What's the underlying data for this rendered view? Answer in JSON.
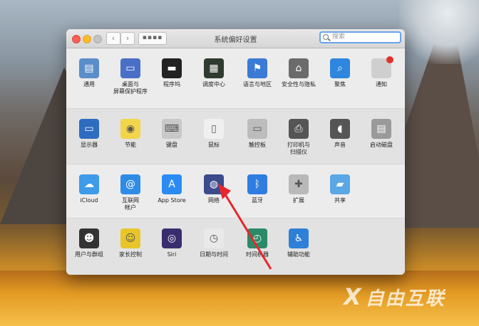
{
  "window": {
    "title": "系统偏好设置",
    "nav_back": "‹",
    "nav_forward": "›",
    "grid_glyph": "▪▪▪▪",
    "search_placeholder": "搜索"
  },
  "rows": [
    [
      {
        "name": "general",
        "label": "通用",
        "icon": "file-doc-icon",
        "color": "#5b8ec9"
      },
      {
        "name": "desktop-screensaver",
        "label": "桌面与\n屏幕保护程序",
        "icon": "desktop-icon",
        "color": "#4a6fc6"
      },
      {
        "name": "dock",
        "label": "程序坞",
        "icon": "dock-icon",
        "color": "#222222"
      },
      {
        "name": "mission-control",
        "label": "调度中心",
        "icon": "mission-control-icon",
        "color": "#2f3b2f"
      },
      {
        "name": "language-region",
        "label": "语言与地区",
        "icon": "flag-icon",
        "color": "#3a7bd5"
      },
      {
        "name": "security-privacy",
        "label": "安全性与隐私",
        "icon": "house-lock-icon",
        "color": "#6b6b6b"
      },
      {
        "name": "spotlight",
        "label": "聚焦",
        "icon": "magnifier-icon",
        "color": "#2e86de"
      },
      {
        "name": "notifications",
        "label": "通知",
        "icon": "notification-icon",
        "color": "#cfcfcf"
      }
    ],
    [
      {
        "name": "displays",
        "label": "显示器",
        "icon": "monitor-icon",
        "color": "#2d6cc0"
      },
      {
        "name": "energy-saver",
        "label": "节能",
        "icon": "bulb-icon",
        "color": "#f2d54b"
      },
      {
        "name": "keyboard",
        "label": "键盘",
        "icon": "keyboard-icon",
        "color": "#c8c8c8"
      },
      {
        "name": "mouse",
        "label": "鼠标",
        "icon": "mouse-icon",
        "color": "#f0f0f0"
      },
      {
        "name": "trackpad",
        "label": "触控板",
        "icon": "trackpad-icon",
        "color": "#bcbcbc"
      },
      {
        "name": "printers-scanners",
        "label": "打印机与\n扫描仪",
        "icon": "printer-icon",
        "color": "#555555"
      },
      {
        "name": "sound",
        "label": "声音",
        "icon": "speaker-icon",
        "color": "#555555"
      },
      {
        "name": "startup-disk",
        "label": "启动磁盘",
        "icon": "disk-icon",
        "color": "#9a9a9a"
      }
    ],
    [
      {
        "name": "icloud",
        "label": "iCloud",
        "icon": "cloud-icon",
        "color": "#3d9be9"
      },
      {
        "name": "internet-accounts",
        "label": "互联网\n帐户",
        "icon": "at-icon",
        "color": "#2e8be6"
      },
      {
        "name": "app-store",
        "label": "App Store",
        "icon": "app-store-icon",
        "color": "#2a8cf2"
      },
      {
        "name": "network",
        "label": "网络",
        "icon": "globe-icon",
        "color": "#3b4b8c"
      },
      {
        "name": "bluetooth",
        "label": "蓝牙",
        "icon": "bluetooth-icon",
        "color": "#2f7de1"
      },
      {
        "name": "extensions",
        "label": "扩展",
        "icon": "puzzle-icon",
        "color": "#b9b9b9"
      },
      {
        "name": "sharing",
        "label": "共享",
        "icon": "folder-icon",
        "color": "#5aa7e5"
      }
    ],
    [
      {
        "name": "users-groups",
        "label": "用户与群组",
        "icon": "users-icon",
        "color": "#333333"
      },
      {
        "name": "parental-controls",
        "label": "家长控制",
        "icon": "parental-icon",
        "color": "#e8c62a"
      },
      {
        "name": "siri",
        "label": "Siri",
        "icon": "siri-icon",
        "color": "#3a2d6e"
      },
      {
        "name": "date-time",
        "label": "日期与时间",
        "icon": "clock-icon",
        "color": "#e9e9e9"
      },
      {
        "name": "time-machine",
        "label": "时间机器",
        "icon": "time-machine-icon",
        "color": "#2b8a67"
      },
      {
        "name": "accessibility",
        "label": "辅助功能",
        "icon": "accessibility-icon",
        "color": "#2e7fd8"
      }
    ]
  ],
  "watermark": {
    "logo": "X",
    "text": "自由互联"
  }
}
